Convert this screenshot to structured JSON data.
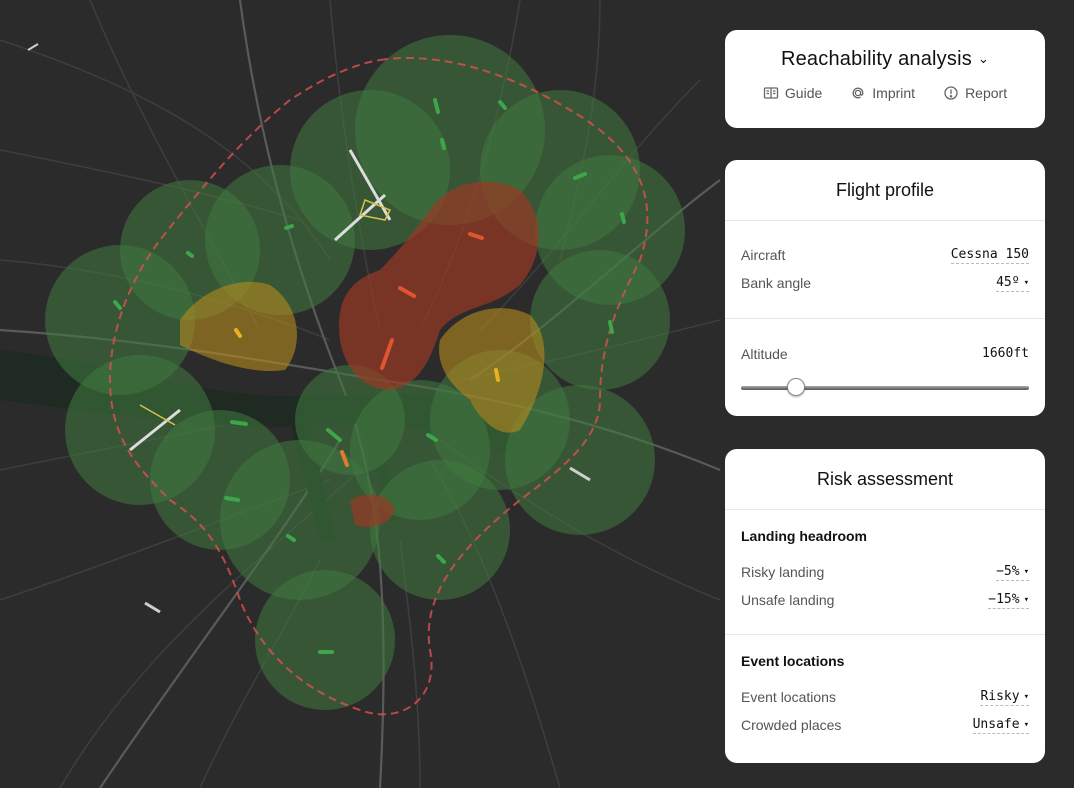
{
  "header": {
    "title": "Reachability analysis",
    "links": [
      {
        "label": "Guide",
        "icon": "book-icon"
      },
      {
        "label": "Imprint",
        "icon": "at-icon"
      },
      {
        "label": "Report",
        "icon": "alert-circle-icon"
      }
    ]
  },
  "flight_profile": {
    "title": "Flight profile",
    "aircraft_label": "Aircraft",
    "aircraft_value": "Cessna 150",
    "bank_label": "Bank angle",
    "bank_value": "45º",
    "altitude_label": "Altitude",
    "altitude_value": "1660ft",
    "altitude_slider_fraction": 0.17
  },
  "risk_assessment": {
    "title": "Risk assessment",
    "landing_section": "Landing headroom",
    "risky_label": "Risky landing",
    "risky_value": "−5%",
    "unsafe_label": "Unsafe landing",
    "unsafe_value": "−15%",
    "event_section": "Event locations",
    "event_label": "Event locations",
    "event_value": "Risky",
    "crowded_label": "Crowded places",
    "crowded_value": "Unsafe"
  },
  "colors": {
    "map_background": "#2b2b2b",
    "safe_zone": "#3f7a3f",
    "risky_zone": "#b58a1e",
    "unsafe_zone": "#9a3b24",
    "boundary": "#e05050"
  }
}
